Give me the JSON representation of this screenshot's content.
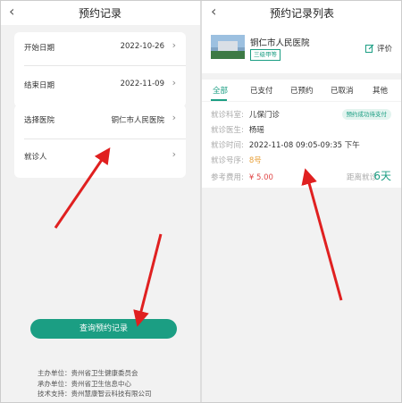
{
  "left": {
    "title": "预约记录",
    "start_date": {
      "label": "开始日期",
      "value": "2022-10-26"
    },
    "end_date": {
      "label": "结束日期",
      "value": "2022-11-09"
    },
    "hospital": {
      "label": "选择医院",
      "value": "铜仁市人民医院"
    },
    "patient": {
      "label": "就诊人",
      "value": ""
    },
    "query_button": "查询预约记录",
    "footer": {
      "sponsor": "主办单位：贵州省卫生健康委员会",
      "organizer": "承办单位：贵州省卫生信息中心",
      "support": "技术支持：贵州慧康智云科技有限公司"
    }
  },
  "right": {
    "title": "预约记录列表",
    "hospital_name": "铜仁市人民医院",
    "hospital_level": "三级甲等",
    "rate_label": "评价",
    "tabs": [
      "全部",
      "已支付",
      "已预约",
      "已取消",
      "其他"
    ],
    "active_tab": "全部",
    "appointment": {
      "status": "预约成功待支付",
      "dept_label": "就诊科室:",
      "dept": "儿保门诊",
      "doctor_label": "就诊医生:",
      "doctor": "杨瑶",
      "time_label": "就诊时间:",
      "time": "2022-11-08 09:05-09:35 下午",
      "number_label": "就诊号序:",
      "number": "8号",
      "fee_label": "参考费用:",
      "fee": "¥ 5.00",
      "countdown_label": "距离就诊",
      "countdown": "6天"
    }
  },
  "colors": {
    "accent": "#1b9e83",
    "arrow": "#e02020",
    "fee": "#e04848"
  }
}
